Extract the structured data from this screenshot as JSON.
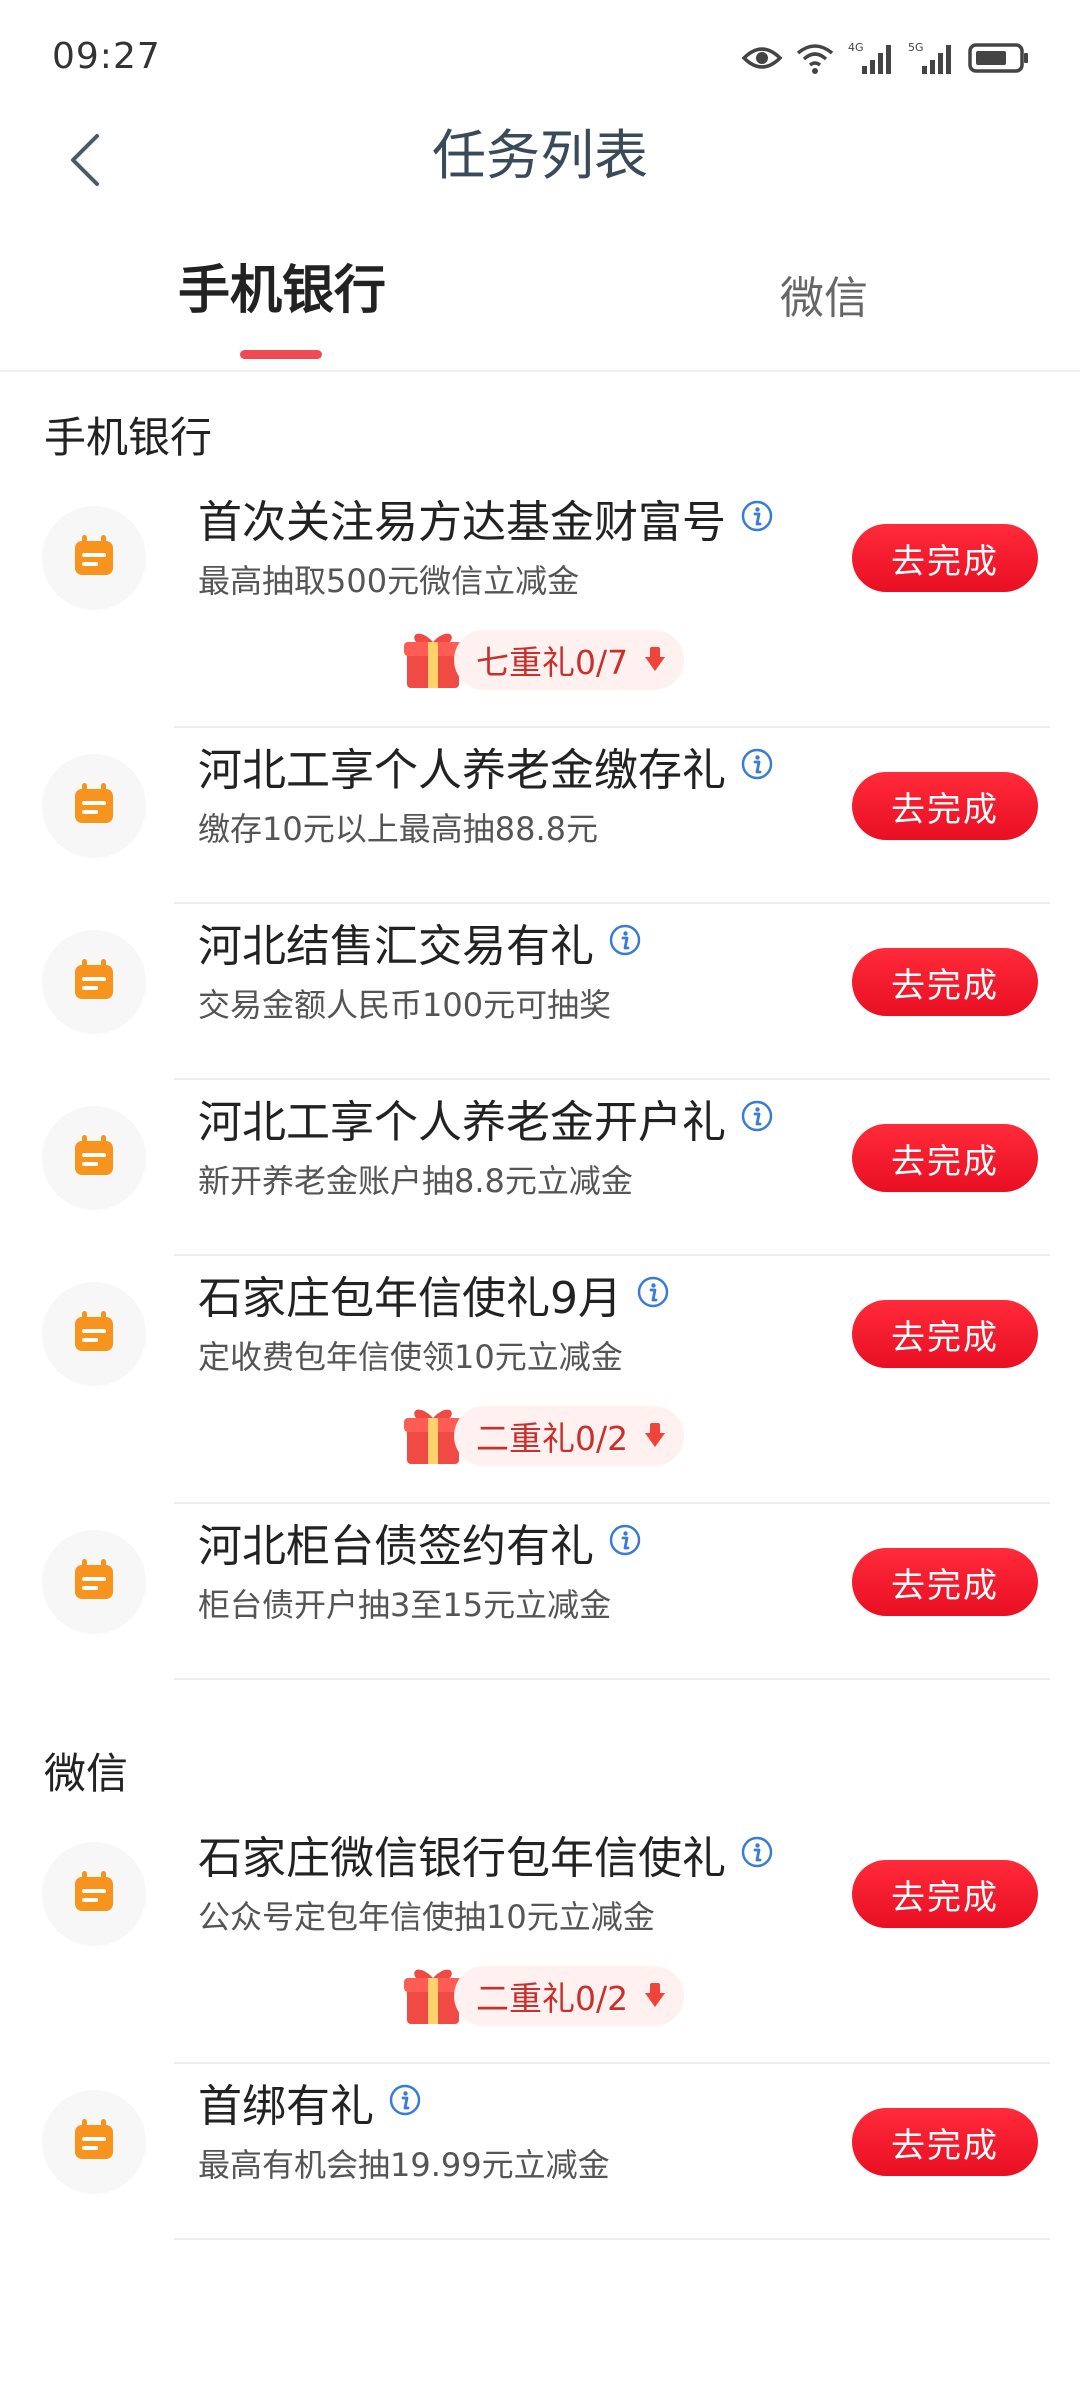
{
  "status_bar": {
    "time": "09:27"
  },
  "header": {
    "title": "任务列表"
  },
  "tabs": [
    {
      "label": "手机银行",
      "active": true
    },
    {
      "label": "微信",
      "active": false
    }
  ],
  "sections": [
    {
      "title": "手机银行",
      "tasks": [
        {
          "title": "首次关注易方达基金财富号",
          "subtitle": "最高抽取500元微信立减金",
          "button": "去完成",
          "gift": "七重礼0/7"
        },
        {
          "title": "河北工享个人养老金缴存礼",
          "subtitle": "缴存10元以上最高抽88.8元",
          "button": "去完成"
        },
        {
          "title": "河北结售汇交易有礼",
          "subtitle": "交易金额人民币100元可抽奖",
          "button": "去完成"
        },
        {
          "title": "河北工享个人养老金开户礼",
          "subtitle": "新开养老金账户抽8.8元立减金",
          "button": "去完成"
        },
        {
          "title": "石家庄包年信使礼9月",
          "subtitle": "定收费包年信使领10元立减金",
          "button": "去完成",
          "gift": "二重礼0/2"
        },
        {
          "title": "河北柜台债签约有礼",
          "subtitle": "柜台债开户抽3至15元立减金",
          "button": "去完成"
        }
      ]
    },
    {
      "title": "微信",
      "tasks": [
        {
          "title": "石家庄微信银行包年信使礼",
          "subtitle": "公众号定包年信使抽10元立减金",
          "button": "去完成",
          "gift": "二重礼0/2"
        },
        {
          "title": "首绑有礼",
          "subtitle": "最高有机会抽19.99元立减金",
          "button": "去完成"
        }
      ]
    }
  ],
  "colors": {
    "accent": "#ef4b55",
    "button": "#f01a2c",
    "icon": "#f7941d"
  }
}
